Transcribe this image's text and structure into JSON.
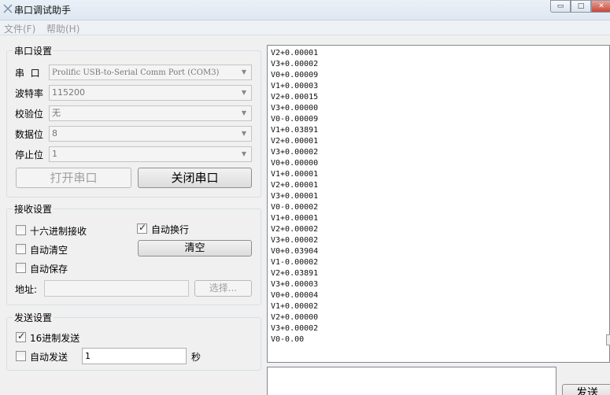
{
  "window": {
    "title": "串口调试助手",
    "min_label": "▭",
    "max_label": "□",
    "close_label": "✕"
  },
  "menu": {
    "file": "文件(F)",
    "help": "帮助(H)"
  },
  "serial_settings": {
    "title": "串口设置",
    "port_label": "串  口",
    "port_value": "Prolific USB-to-Serial Comm Port (COM3)",
    "baud_label": "波特率",
    "baud_value": "115200",
    "parity_label": "校验位",
    "parity_value": "无",
    "databits_label": "数据位",
    "databits_value": "8",
    "stopbits_label": "停止位",
    "stopbits_value": "1",
    "open_button": "打开串口",
    "close_button": "关闭串口"
  },
  "receive_settings": {
    "title": "接收设置",
    "hex_receive": {
      "label": "十六进制接收",
      "checked": false
    },
    "auto_wrap": {
      "label": "自动换行",
      "checked": true
    },
    "auto_clear": {
      "label": "自动清空",
      "checked": false
    },
    "clear_button": "清空",
    "auto_save": {
      "label": "自动保存",
      "checked": false
    },
    "address_label": "地址:",
    "address_value": "",
    "browse_button": "选择..."
  },
  "send_settings": {
    "title": "发送设置",
    "hex_send": {
      "label": "16进制发送",
      "checked": true
    },
    "auto_send": {
      "label": "自动发送",
      "checked": false
    },
    "interval_value": "1",
    "interval_unit": "秒"
  },
  "receive_lines": [
    "V2+0.00001",
    "V3+0.00002",
    "V0+0.00009",
    "V1+0.00003",
    "V2+0.00015",
    "V3+0.00000",
    "V0-0.00009",
    "V1+0.03891",
    "V2+0.00001",
    "V3+0.00002",
    "V0+0.00000",
    "V1+0.00001",
    "V2+0.00001",
    "V3+0.00001",
    "V0-0.00002",
    "V1+0.00001",
    "V2+0.00002",
    "V3+0.00002",
    "V0+0.03904",
    "V1-0.00002",
    "V2+0.03891",
    "V3+0.00003",
    "V0+0.00004",
    "V1+0.00002",
    "V2+0.00000",
    "V3+0.00002",
    "V0-0.00"
  ],
  "send_box_value": "",
  "send_button": "发送"
}
